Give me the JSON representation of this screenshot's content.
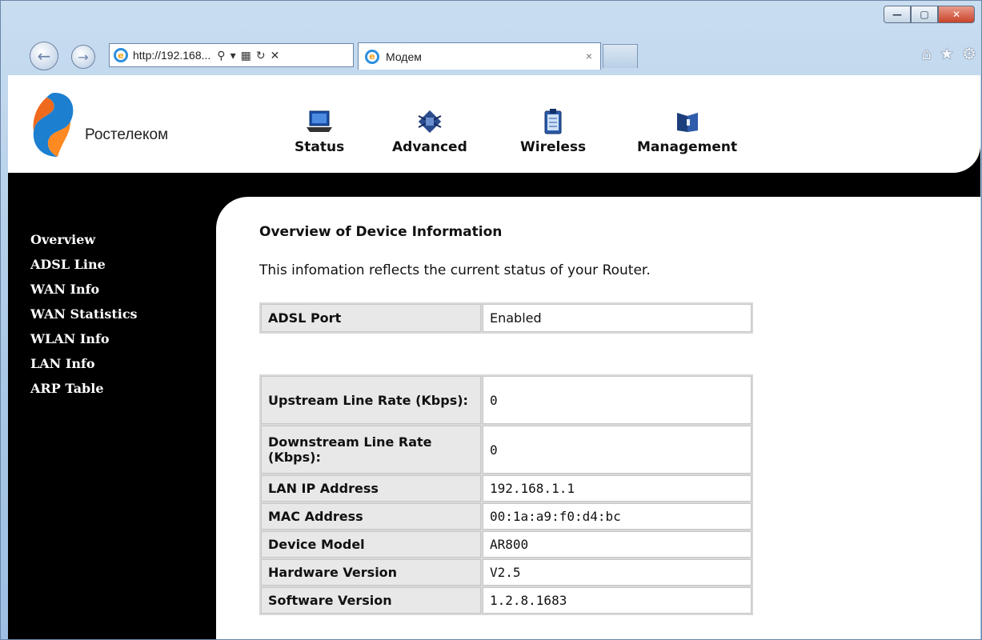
{
  "browser": {
    "address_url": "http://192.168...",
    "tab_title": "Модем",
    "tab_close": "×"
  },
  "brand": "Ростелеком",
  "topnav": [
    {
      "label": "Status",
      "icon": "laptop-icon"
    },
    {
      "label": "Advanced",
      "icon": "chip-icon"
    },
    {
      "label": "Wireless",
      "icon": "clipboard-icon"
    },
    {
      "label": "Management",
      "icon": "book-icon"
    }
  ],
  "sidemenu": [
    "Overview",
    "ADSL Line",
    "WAN Info",
    "WAN Statistics",
    "WLAN Info",
    "LAN Info",
    "ARP Table"
  ],
  "page": {
    "title": "Overview of Device Information",
    "description": "This infomation reflects the current status of your Router."
  },
  "port": {
    "label": "ADSL Port",
    "value": "Enabled"
  },
  "stats": [
    {
      "label": "Upstream Line Rate (Kbps):",
      "value": "0"
    },
    {
      "label": "Downstream Line Rate (Kbps):",
      "value": "0"
    },
    {
      "label": "LAN IP Address",
      "value": "192.168.1.1"
    },
    {
      "label": "MAC Address",
      "value": "00:1a:a9:f0:d4:bc"
    },
    {
      "label": "Device Model",
      "value": "AR800"
    },
    {
      "label": "Hardware Version",
      "value": "V2.5"
    },
    {
      "label": "Software Version",
      "value": "1.2.8.1683"
    }
  ]
}
